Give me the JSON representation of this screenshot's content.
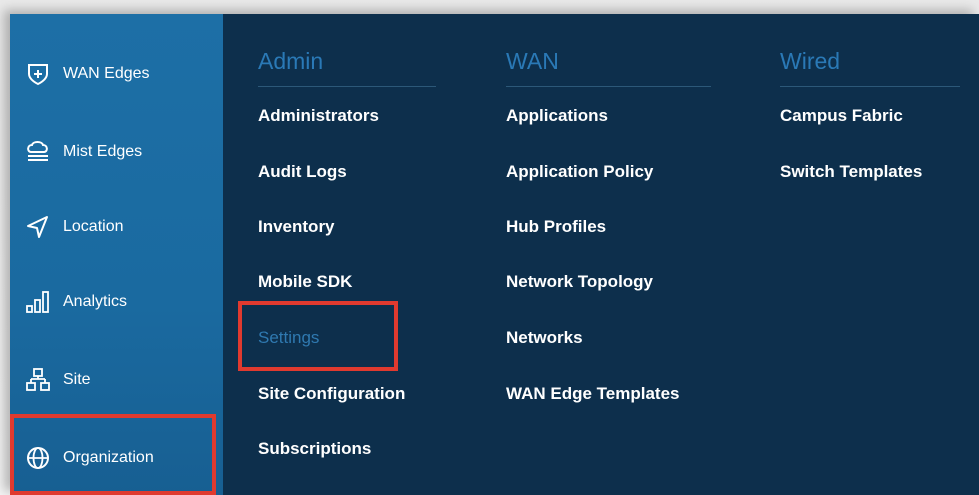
{
  "sidebar": {
    "items": [
      {
        "label": "WAN Edges",
        "icon": "plus-shield-icon"
      },
      {
        "label": "Mist Edges",
        "icon": "cloud-stack-icon"
      },
      {
        "label": "Location",
        "icon": "location-arrow-icon"
      },
      {
        "label": "Analytics",
        "icon": "bar-chart-icon"
      },
      {
        "label": "Site",
        "icon": "site-hierarchy-icon"
      },
      {
        "label": "Organization",
        "icon": "globe-icon"
      }
    ]
  },
  "menu": {
    "columns": [
      {
        "header": "Admin",
        "items": [
          "Administrators",
          "Audit Logs",
          "Inventory",
          "Mobile SDK",
          "Settings",
          "Site Configuration",
          "Subscriptions"
        ]
      },
      {
        "header": "WAN",
        "items": [
          "Applications",
          "Application Policy",
          "Hub Profiles",
          "Network Topology",
          "Networks",
          "WAN Edge Templates"
        ]
      },
      {
        "header": "Wired",
        "items": [
          "Campus Fabric",
          "Switch Templates"
        ]
      }
    ]
  },
  "colors": {
    "sidebar": "#1a6aa0",
    "menu_bg": "#0d2f4c",
    "header": "#2a79b6",
    "active_link": "#2f79b0",
    "highlight": "#e03a2f"
  }
}
